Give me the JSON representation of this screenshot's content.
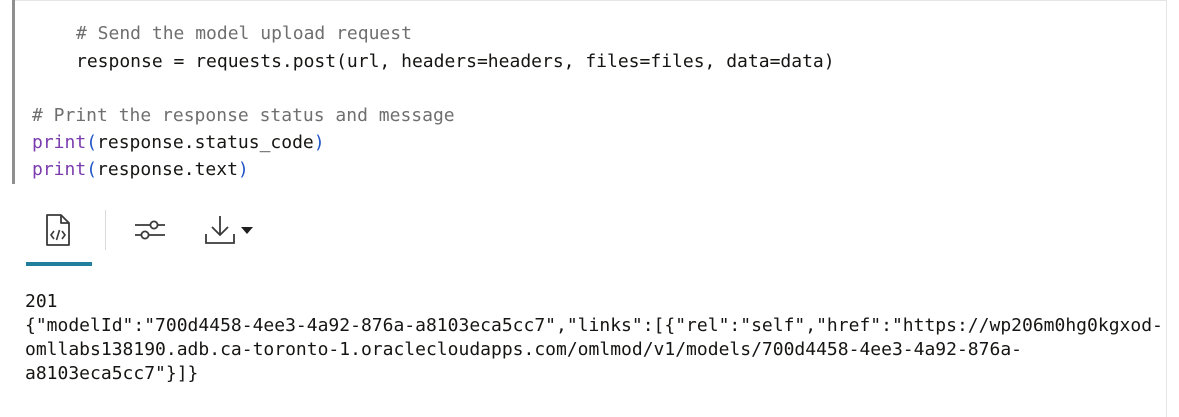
{
  "code_cell": {
    "lines": [
      {
        "comment": "# Send the model upload request"
      },
      {
        "text": "response = requests.post(url, headers=headers, files=files, data=data)"
      },
      {
        "comment": "# Print the response status and message"
      },
      {
        "fn": "print",
        "open": "(",
        "arg": "response.status_code",
        "close": ")"
      },
      {
        "fn": "print",
        "open": "(",
        "arg": "response.text",
        "close": ")"
      }
    ]
  },
  "toolbar": {
    "code_view_icon": "code-file-icon",
    "settings_icon": "sliders-icon",
    "download_icon": "download-icon",
    "dropdown_icon": "caret-down-icon",
    "accent_color": "#227e9e"
  },
  "output": {
    "lines": [
      "201",
      "{\"modelId\":\"700d4458-4ee3-4a92-876a-a8103eca5cc7\",\"links\":[{\"rel\":\"self\",\"href\":\"https://wp206m0hg0kgxod-",
      "omllabs138190.adb.ca-toronto-1.oraclecloudapps.com/omlmod/v1/models/700d4458-4ee3-4a92-876a-",
      "a8103eca5cc7\"}]}"
    ]
  }
}
